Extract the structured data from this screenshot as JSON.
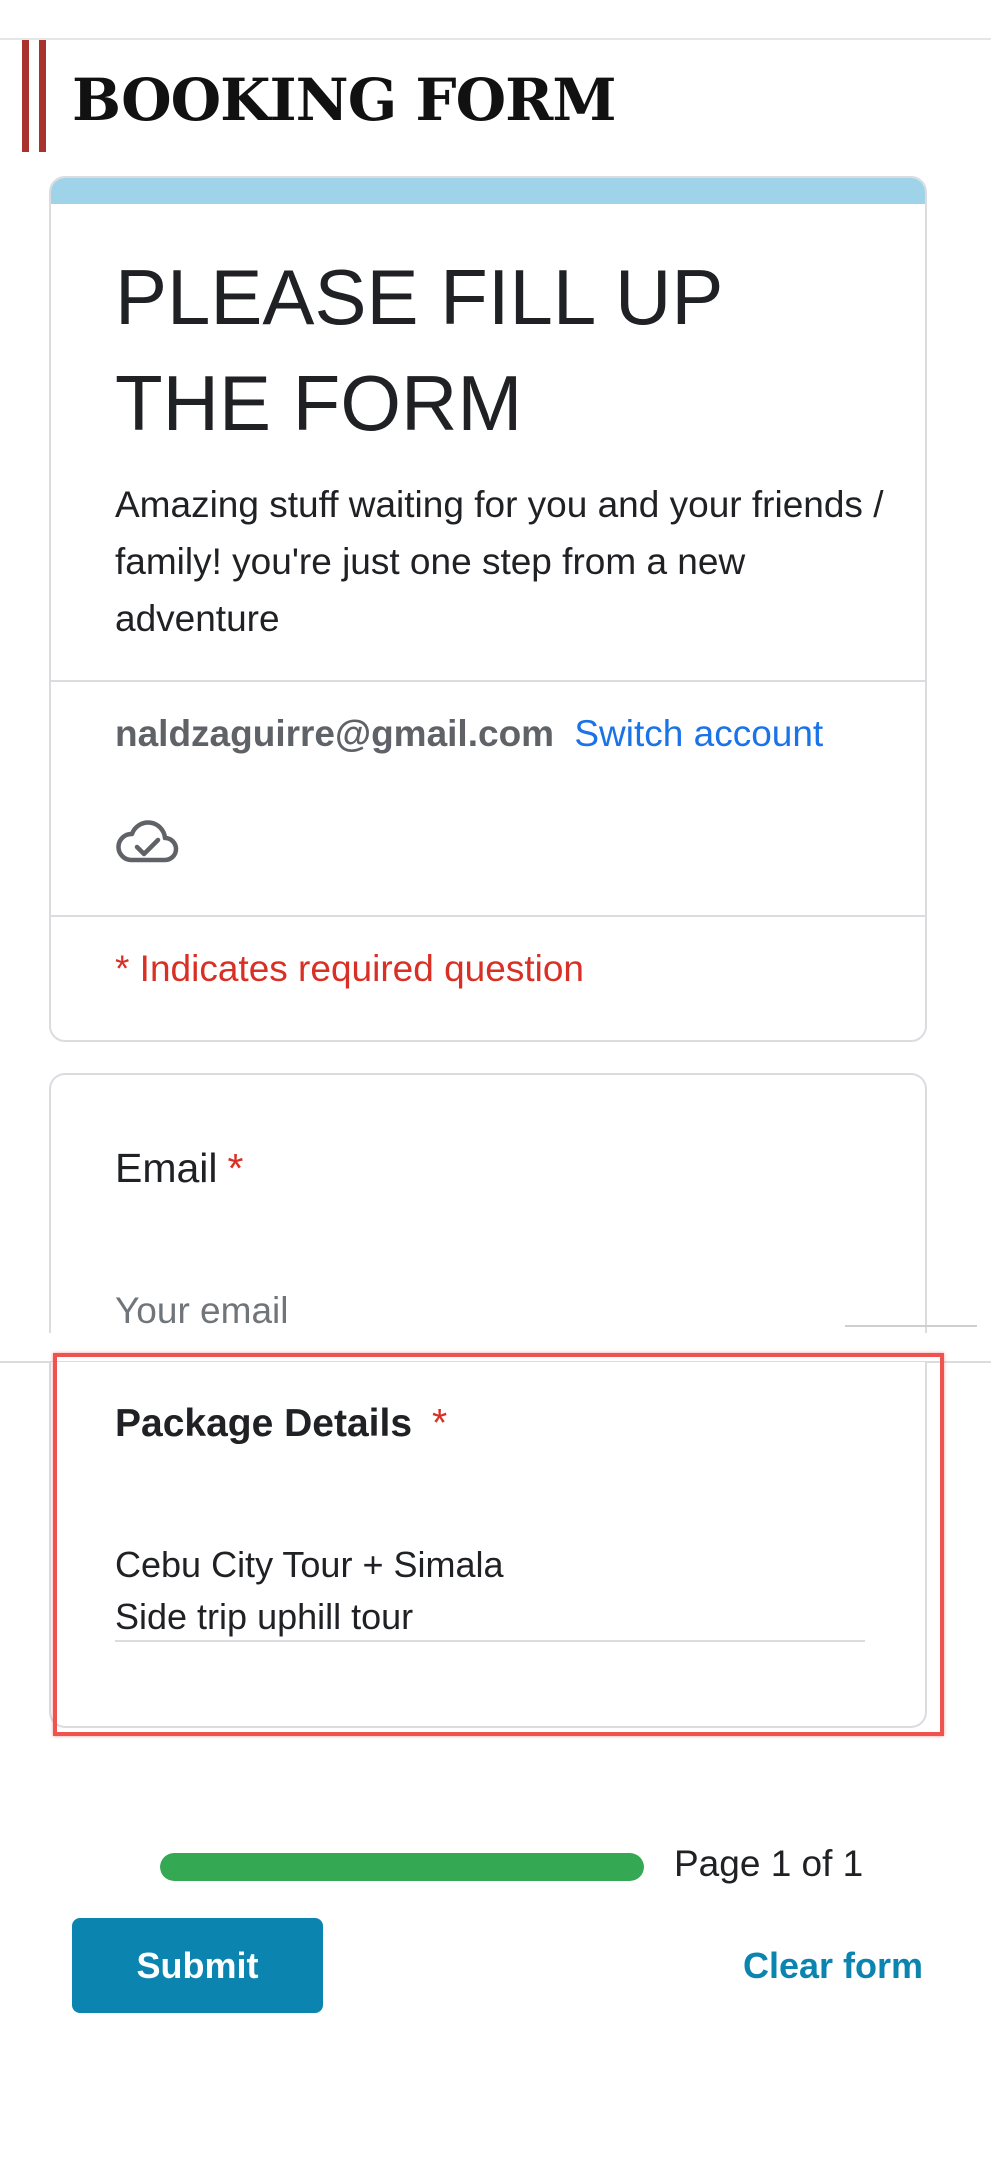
{
  "page": {
    "heading": "BOOKING FORM"
  },
  "form": {
    "title": "PLEASE FILL UP THE FORM",
    "description": "Amazing stuff waiting for you and your friends / family! you're just one step from a new adventure",
    "account_email": "naldzaguirre@gmail.com",
    "switch_account": "Switch account",
    "required_note": "* Indicates required question",
    "accent_color": "#9fd3ea"
  },
  "questions": {
    "email": {
      "label": "Email",
      "required_mark": "*",
      "placeholder": "Your email"
    },
    "package": {
      "label": "Package Details",
      "required_mark": "*",
      "answer": "Cebu City Tour + Simala\nSide trip uphill tour"
    }
  },
  "footer": {
    "progress_percent": 100,
    "page_indicator": "Page 1 of 1",
    "submit_label": "Submit",
    "clear_label": "Clear form",
    "brand_color": "#0b85b0",
    "progress_color": "#34a853"
  },
  "icons": {
    "saved": "cloud-check-icon"
  }
}
